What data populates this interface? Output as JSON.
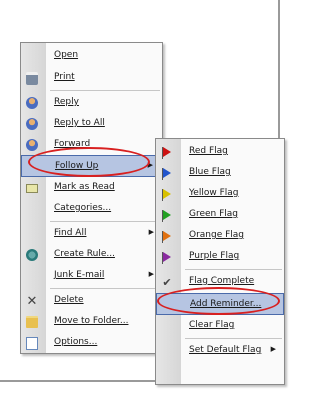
{
  "main_menu": {
    "items": [
      {
        "label": "Open",
        "icon": "none"
      },
      {
        "label": "Print",
        "icon": "printer-icon"
      },
      {
        "label": "Reply",
        "icon": "reply-icon"
      },
      {
        "label": "Reply to All",
        "icon": "reply-all-icon"
      },
      {
        "label": "Forward",
        "icon": "forward-icon"
      },
      {
        "label": "Follow Up",
        "icon": "none",
        "submenu": true,
        "highlighted": true
      },
      {
        "label": "Mark as Read",
        "icon": "envelope-icon"
      },
      {
        "label": "Categories...",
        "icon": "none"
      },
      {
        "label": "Find All",
        "icon": "none",
        "submenu": true
      },
      {
        "label": "Create Rule...",
        "icon": "rule-icon"
      },
      {
        "label": "Junk E-mail",
        "icon": "none",
        "submenu": true
      },
      {
        "label": "Delete",
        "icon": "delete-x-icon"
      },
      {
        "label": "Move to Folder...",
        "icon": "move-folder-icon"
      },
      {
        "label": "Options...",
        "icon": "options-icon"
      }
    ],
    "submenu_arrow": "▶"
  },
  "flag_menu": {
    "items": [
      {
        "label": "Red Flag",
        "color": "#cc1111"
      },
      {
        "label": "Blue Flag",
        "color": "#2255cc"
      },
      {
        "label": "Yellow Flag",
        "color": "#d8c000"
      },
      {
        "label": "Green Flag",
        "color": "#22a022"
      },
      {
        "label": "Orange Flag",
        "color": "#e07010"
      },
      {
        "label": "Purple Flag",
        "color": "#8a2aa0"
      },
      {
        "label": "Flag Complete",
        "color": "#444444"
      },
      {
        "label": "Add Reminder...",
        "highlighted": true
      },
      {
        "label": "Clear Flag"
      },
      {
        "label": "Set Default Flag",
        "submenu": true
      }
    ]
  },
  "annotation_color": "#d82020",
  "highlight_color": "#b6c5e2"
}
